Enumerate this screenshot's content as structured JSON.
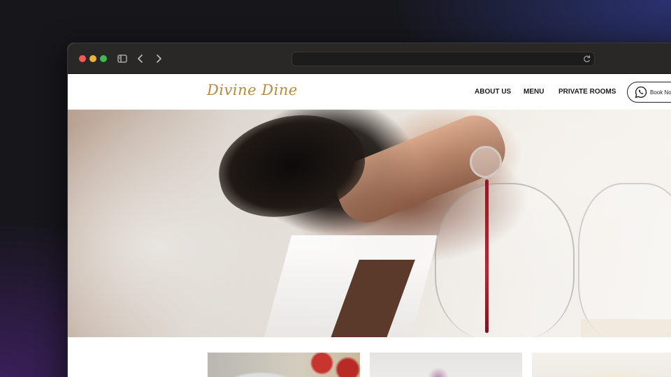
{
  "browser": {
    "url": "",
    "icons": [
      "sidebar-toggle-icon",
      "back-icon",
      "forward-icon",
      "reload-icon"
    ]
  },
  "site": {
    "logo_text": "Divine Dine",
    "brand_color": "#b68b3e",
    "nav": {
      "about": "ABOUT US",
      "menu": "MENU",
      "private_rooms": "PRIVATE ROOMS"
    },
    "book_button": {
      "label": "Book No",
      "icon": "whatsapp-icon"
    }
  },
  "hero": {
    "image": "waiter-pouring-red-wine"
  },
  "cards": [
    {
      "image": "dessert-plate-strawberries"
    },
    {
      "image": "dark-plate-dish"
    },
    {
      "image": "orange-soup-plate"
    }
  ]
}
